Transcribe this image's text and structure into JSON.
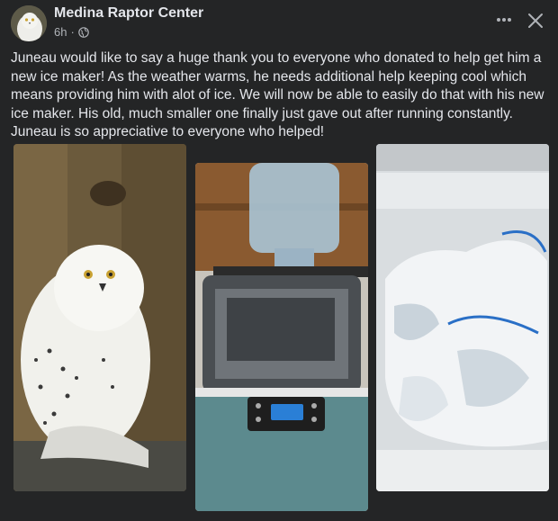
{
  "post": {
    "author": "Medina Raptor Center",
    "time": "6h",
    "separator": "·",
    "audience_icon": "globe-icon",
    "more_icon": "more-options-icon",
    "close_icon": "close-icon",
    "text": "Juneau would like to say a huge thank you to everyone who donated to help get him a new ice maker!  As the weather warms, he needs additional help keeping cool which means providing him with alot of ice. We will now be able to easily do that with his new ice maker. His old, much smaller one finally just gave out after running constantly. Juneau is so appreciative to everyone who helped!",
    "photos": [
      {
        "subject": "snowy-owl-photo"
      },
      {
        "subject": "ice-maker-photo"
      },
      {
        "subject": "ice-bags-photo"
      }
    ]
  },
  "colors": {
    "background": "#242526",
    "text": "#e4e6eb",
    "secondary_text": "#b0b3b8"
  }
}
